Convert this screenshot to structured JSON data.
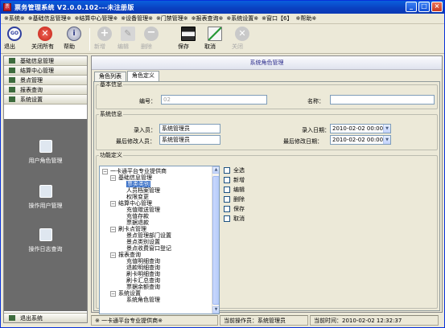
{
  "window": {
    "icon_text": "票",
    "title": "票务管理系统 V2.0.0.102---未注册版",
    "buttons": {
      "minimize": "_",
      "maximize": "□",
      "close": "×"
    }
  },
  "menu": [
    "※系统※",
    "※基础信息管理※",
    "※结算中心管理※",
    "※设备管理※",
    "※门禁管理※",
    "※报表查询※",
    "※系统设置※",
    "※窗口【6】",
    "※帮助※"
  ],
  "toolbar": {
    "exit": "退出",
    "close_all": "关闭所有",
    "help": "帮助",
    "add": "新增",
    "edit": "编辑",
    "delete": "删除",
    "save": "保存",
    "cancel": "取消",
    "close": "关闭"
  },
  "sidebar": {
    "items": [
      "基础信息管理",
      "结算中心管理",
      "景点管理",
      "报表查询",
      "系统设置"
    ],
    "panel_items": [
      "用户角色管理",
      "操作用户管理",
      "操作日志查询"
    ],
    "exit": "退出系统"
  },
  "main": {
    "header": "系统角色管理",
    "tabs": [
      "角色列表",
      "角色定义"
    ],
    "basic": {
      "legend": "基本信息",
      "code_label": "编号：",
      "code_value": "02",
      "name_label": "名称："
    },
    "sysinfo": {
      "legend": "系统信息",
      "entry_user_label": "录入员：",
      "entry_user_value": "系统管理员",
      "modify_user_label": "最后修改人员：",
      "modify_user_value": "系统管理员",
      "entry_date_label": "录入日期：",
      "entry_date_value": "2010-02-02 00:00:00",
      "modify_date_label": "最后修改日期：",
      "modify_date_value": "2010-02-02 00:00:00"
    },
    "func": {
      "legend": "功能定义",
      "tree": [
        "一卡通平台专业提供商",
        "基础信息管理",
        "票类类别",
        "人员档案管理",
        "权限变更",
        "结算中心管理",
        "充值赠送管理",
        "充值存款",
        "票据退款",
        "刷卡点管理",
        "景点管理部门设置",
        "景点类别设置",
        "景点收费窗口登记",
        "报表查询",
        "充值明细查询",
        "退款明细查询",
        "刷卡明细查询",
        "刷卡汇总查询",
        "票据余额查询",
        "系统设置",
        "系统角色管理"
      ],
      "perms": [
        "全选",
        "新增",
        "编辑",
        "删除",
        "保存",
        "取消"
      ]
    }
  },
  "status": {
    "company": "※  一卡通平台专业提供商※",
    "operator": "当前操作员：系统管理员",
    "time": "当前时间：2010-02-02  12:32:37"
  },
  "colors": {
    "titlebar": "#0a3fc0",
    "side_panel": "#6b6b6b",
    "selection": "#316ac5"
  }
}
